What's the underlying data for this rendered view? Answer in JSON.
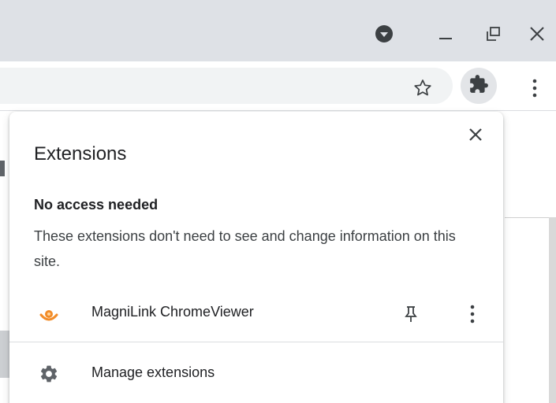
{
  "browser": {
    "window_controls": {
      "profile": "profile-icon",
      "minimize": "minimize-icon",
      "restore": "restore-icon",
      "close": "close-icon"
    },
    "toolbar": {
      "bookmark": "star-icon",
      "extensions": "puzzle-piece-icon",
      "menu": "kebab-menu-icon"
    }
  },
  "extensions_popup": {
    "title": "Extensions",
    "close": "close-icon",
    "section": {
      "heading": "No access needed",
      "description": "These extensions don't need to see and change information on this site."
    },
    "items": [
      {
        "name": "MagniLink ChromeViewer",
        "icon": "magnilink-icon",
        "pin": "pin-icon",
        "more": "kebab-menu-icon"
      }
    ],
    "manage": {
      "label": "Manage extensions",
      "icon": "gear-icon"
    }
  },
  "colors": {
    "titlebar": "#dee1e6",
    "omnibox": "#f1f3f4",
    "extension_button_bg": "#e3e5e8",
    "text_primary": "#202124",
    "text_secondary": "#3c4043",
    "icon_gray": "#5f6368",
    "magnilink_orange": "#f28c28"
  }
}
